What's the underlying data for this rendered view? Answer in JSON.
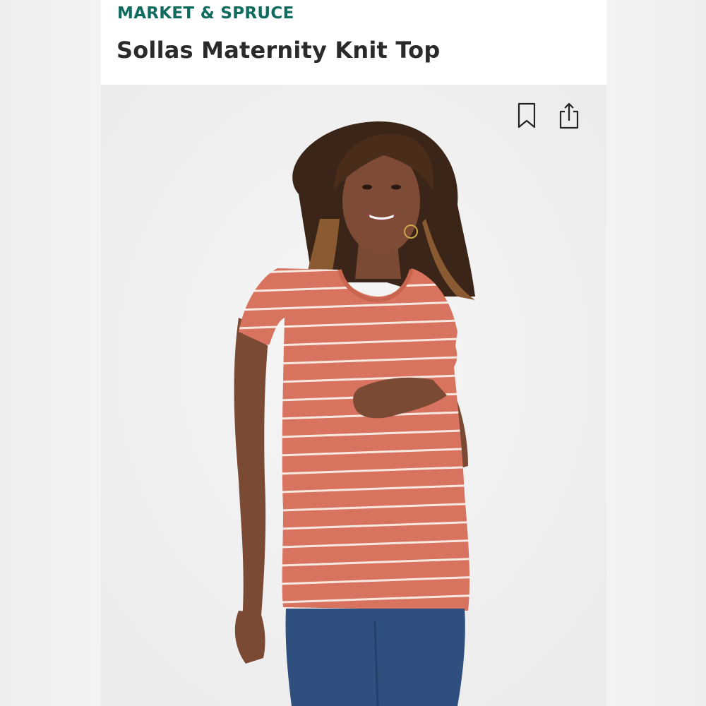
{
  "header": {
    "brand": "MARKET & SPRUCE",
    "title": "Sollas Maternity Knit Top"
  },
  "actions": {
    "bookmark_icon": "bookmark-icon",
    "share_icon": "share-icon"
  },
  "colors": {
    "brand": "#0f6b5d",
    "title": "#2a2a2a",
    "top_fabric": "#d8735f",
    "stripe": "#f7e9df",
    "denim": "#2f4f7f"
  }
}
